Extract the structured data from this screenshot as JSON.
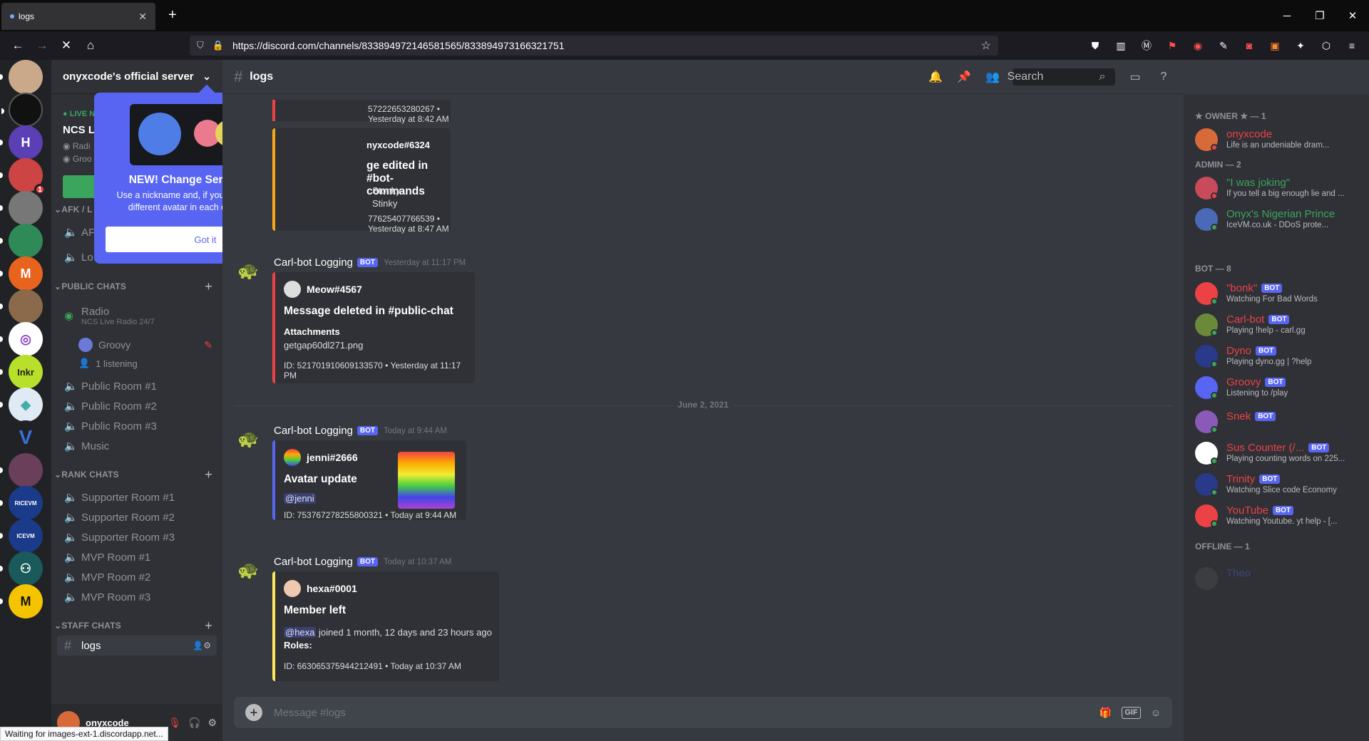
{
  "browser": {
    "tab_title": "logs",
    "url": "https://discord.com/channels/833894972146581565/833894973166321751",
    "status_text": "Waiting for images-ext-1.discordapp.net..."
  },
  "server": {
    "name": "onyxcode's official server",
    "live_label": "LIVE N",
    "live_title": "NCS Li",
    "live_sub1": "Radi",
    "live_sub2": "Groo",
    "afk_cat": "AFK / L",
    "afk_ch1": "AF",
    "afk_ch2": "Lo"
  },
  "popout": {
    "title": "NEW! Change Server Identity",
    "body": "Use a nickname and, if you have Nitro, use a different avatar in each of your servers.",
    "button": "Got it"
  },
  "categories": {
    "public": "PUBLIC CHATS",
    "rank": "RANK CHATS",
    "staff": "STAFF CHATS"
  },
  "channels": {
    "radio": "Radio",
    "radio_sub": "NCS Live Radio 24/7",
    "groovy": "Groovy",
    "listening": "1 listening",
    "public1": "Public Room #1",
    "public2": "Public Room #2",
    "public3": "Public Room #3",
    "music": "Music",
    "sup1": "Supporter Room #1",
    "sup2": "Supporter Room #2",
    "sup3": "Supporter Room #3",
    "mvp1": "MVP Room #1",
    "mvp2": "MVP Room #2",
    "mvp3": "MVP Room #3",
    "logs": "logs"
  },
  "user": {
    "name": "onyxcode"
  },
  "channel_header": {
    "name": "logs",
    "search_placeholder": "Search"
  },
  "messages": {
    "top_embed_id": "57222653280267 • Yesterday at 8:42 AM",
    "edit_author": "nyxcode#6324",
    "edit_title": "ge edited in #bot-commands",
    "edit_before": "Stonky",
    "edit_after": "Stinky",
    "edit_id": "77625407766539 • Yesterday at 8:47 AM",
    "m1_author": "Carl-bot Logging",
    "m1_ts": "Yesterday at 11:17 PM",
    "m1_embed_author": "Meow#4567",
    "m1_embed_title": "Message deleted in #public-chat",
    "m1_field": "Attachments",
    "m1_file": "getgap60dl271.png",
    "m1_id": "ID: 521701910609133570 • Yesterday at 11:17 PM",
    "date_divider": "June 2, 2021",
    "m2_author": "Carl-bot Logging",
    "m2_ts": "Today at 9:44 AM",
    "m2_embed_author": "jenni#2666",
    "m2_embed_title": "Avatar update",
    "m2_mention": "@jenni",
    "m2_id": "ID: 753767278255800321 • Today at 9:44 AM",
    "m3_author": "Carl-bot Logging",
    "m3_ts": "Today at 10:37 AM",
    "m3_embed_author": "hexa#0001",
    "m3_embed_title": "Member left",
    "m3_mention": "@hexa",
    "m3_text": "joined 1 month, 12 days and 23 hours ago",
    "m3_roles": "Roles:",
    "m3_id": "ID: 663065375944212491 • Today at 10:37 AM",
    "bot_tag": "BOT"
  },
  "composer": {
    "placeholder": "Message #logs"
  },
  "members": {
    "owner_cat": "★ OWNER ★ — 1",
    "admin_cat": "ADMIN — 2",
    "bot_cat": "BOT — 8",
    "offline_cat": "OFFLINE — 1",
    "list": [
      {
        "name": "onyxcode",
        "status": "Life is an undeniable dram...",
        "color": "#ed4245"
      },
      {
        "name": "\"I was joking\"",
        "status": "If you tell a big enough lie and ...",
        "color": "#3ba55d"
      },
      {
        "name": "Onyx's Nigerian Prince",
        "status": "IceVM.co.uk - DDoS prote...",
        "color": "#3ba55d"
      },
      {
        "name": "\"bonk\"",
        "status": "Watching For Bad Words",
        "color": "#ed4245"
      },
      {
        "name": "Carl-bot",
        "status": "Playing !help - carl.gg",
        "color": "#ed4245"
      },
      {
        "name": "Dyno",
        "status": "Playing dyno.gg | ?help",
        "color": "#ed4245"
      },
      {
        "name": "Groovy",
        "status": "Listening to /play",
        "color": "#ed4245"
      },
      {
        "name": "Snek",
        "status": "",
        "color": "#ed4245"
      },
      {
        "name": "Sus Counter (/...",
        "status": "Playing counting words on 225...",
        "color": "#ed4245"
      },
      {
        "name": "Trinity",
        "status": "Watching Slice code Economy",
        "color": "#ed4245"
      },
      {
        "name": "YouTube",
        "status": "Watching Youtube. yt help - [...",
        "color": "#ed4245"
      },
      {
        "name": "Theo",
        "status": "",
        "color": "#5865f2"
      }
    ]
  }
}
